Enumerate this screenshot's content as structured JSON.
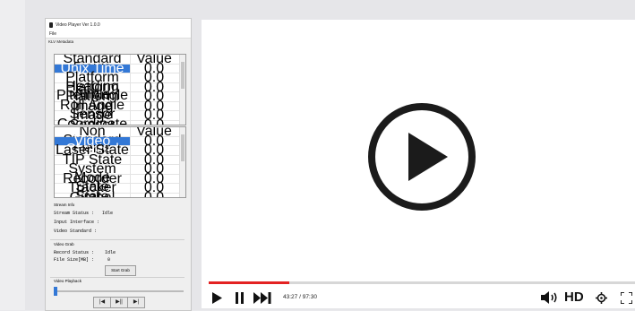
{
  "app": {
    "title": "Video Player Ver 1.0.0",
    "menu_file": "File",
    "klv_group": "KLV Metadata",
    "klv_table": {
      "headers": [
        "Standard Fields",
        "Value"
      ],
      "rows": [
        {
          "field": "Unix Time Stamp",
          "value": "0.0",
          "selected": true
        },
        {
          "field": "Platform Heading Angle",
          "value": "0.0"
        },
        {
          "field": "Platform Pitch Angle",
          "value": "0.0"
        },
        {
          "field": "Platform Roll Angle",
          "value": "0.0"
        },
        {
          "field": "Image Sensor",
          "value": "0.0"
        },
        {
          "field": "Image Coordinate System",
          "value": "0.0"
        },
        {
          "field": "Sensor Latitude",
          "value": "0.0"
        }
      ]
    },
    "nonstd_table": {
      "headers": [
        "Non Standard Fields",
        "Value"
      ],
      "rows": [
        {
          "field": "Video Channel",
          "value": "0.0",
          "selected": true
        },
        {
          "field": "Laser State",
          "value": "0.0"
        },
        {
          "field": "TIP State",
          "value": "0.0"
        },
        {
          "field": "System Mode",
          "value": "0.0"
        },
        {
          "field": "Recorder State",
          "value": "0.0"
        },
        {
          "field": "Tracker State",
          "value": "0.0"
        },
        {
          "field": "Gimbal Mount Position",
          "value": "0.0"
        }
      ]
    },
    "stream_group": "Stream Info",
    "stream_status_label": "Stream Status :",
    "stream_status_value": "Idle",
    "input_interface_label": "Input Interface :",
    "video_standard_label": "Video Standard :",
    "video_grab_group": "Video Grab",
    "record_status_label": "Record Status :",
    "record_status_value": "Idle",
    "file_size_label": "File Size[MB] :",
    "file_size_value": "0",
    "start_grab_label": "Start Grab",
    "playback_group": "Video Playback",
    "btn_prev": "|◀",
    "btn_playpause": "▶||",
    "btn_next": "▶|"
  },
  "player": {
    "current_time": "43:27",
    "separator": " / ",
    "total_time": "97:30",
    "progress_fraction": 0.19,
    "hd_label": "HD",
    "progress_color": "#e32222"
  }
}
